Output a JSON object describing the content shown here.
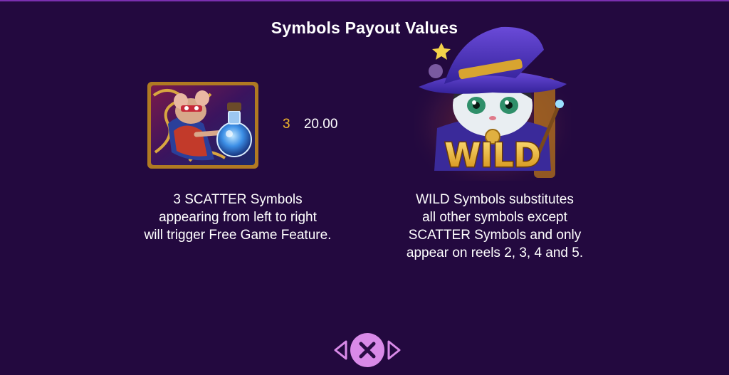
{
  "title": "Symbols Payout Values",
  "scatter": {
    "icon": "scatter-mouse-potion-icon",
    "payout_count": "3",
    "payout_value": "20.00",
    "description": [
      "3 SCATTER Symbols",
      "appearing from left to right",
      "will trigger Free Game Feature."
    ]
  },
  "wild": {
    "icon": "wild-wizard-cat-icon",
    "badge_text": "WILD",
    "description": [
      "WILD Symbols substitutes",
      "all other symbols except",
      "SCATTER Symbols and only",
      "appear on reels 2, 3, 4 and 5."
    ]
  },
  "nav": {
    "prev_icon": "chevron-left-icon",
    "close_icon": "close-icon",
    "next_icon": "chevron-right-icon"
  },
  "colors": {
    "background": "#23093f",
    "payout_count": "#f3b72a",
    "nav_button": "#d98ae8"
  }
}
